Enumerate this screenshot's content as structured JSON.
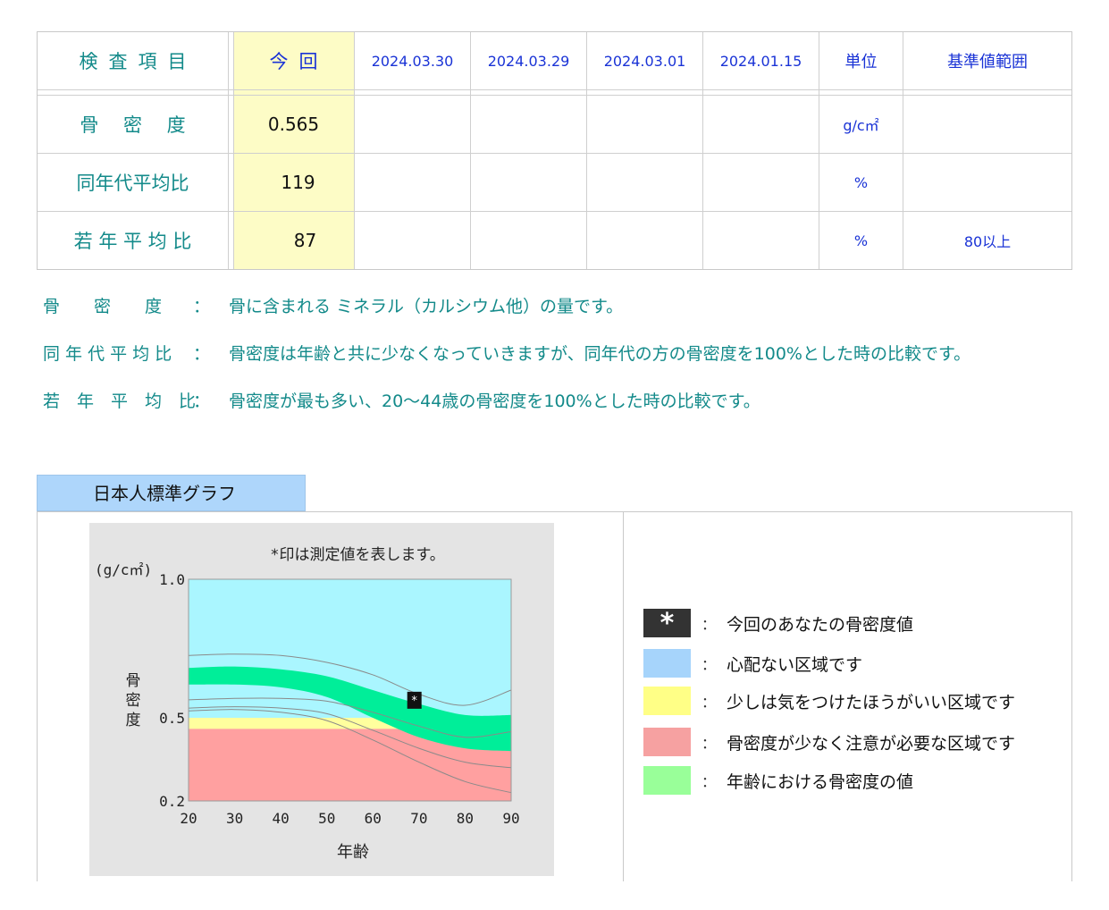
{
  "table": {
    "headers": {
      "item": "検査項目",
      "current": "今回",
      "dates": [
        "2024.03.30",
        "2024.03.29",
        "2024.03.01",
        "2024.01.15"
      ],
      "unit": "単位",
      "reference": "基準値範囲"
    },
    "rows": [
      {
        "label": "骨　 密　 度",
        "current": "0.565",
        "unit": "g/c㎡",
        "reference": ""
      },
      {
        "label": "同年代平均比",
        "current": "119",
        "unit": "%",
        "reference": ""
      },
      {
        "label": "若 年 平 均 比",
        "current": "87",
        "unit": "%",
        "reference": "80以上"
      }
    ]
  },
  "explanations": [
    {
      "term": "骨　　密　　度",
      "colon": "：",
      "text": "骨に含まれる ミネラル（カルシウム他）の量です。"
    },
    {
      "term": "同 年 代 平 均 比",
      "colon": "：",
      "text": "骨密度は年齢と共に少なくなっていきますが、同年代の方の骨密度を100%とした時の比較です。"
    },
    {
      "term": "若　年　平　均　比",
      "colon": "：",
      "text": "骨密度が最も多い、20〜44歳の骨密度を100%とした時の比較です。"
    }
  ],
  "graph": {
    "title": "日本人標準グラフ",
    "note": "*印は測定値を表します。",
    "unit_label": "(g/c㎡)",
    "y_label": "骨密度",
    "x_label": "年齢",
    "marker": "*"
  },
  "chart_data": {
    "type": "area",
    "xlabel": "年齢",
    "ylabel": "骨密度",
    "xlim": [
      20,
      90
    ],
    "ylim": [
      0.2,
      1.0
    ],
    "x_ticks": [
      20,
      30,
      40,
      50,
      60,
      70,
      80,
      90
    ],
    "y_ticks": [
      1.0,
      0.5,
      0.2
    ],
    "y_tick_labels": [
      "1.0",
      "0.5",
      "0.2"
    ],
    "zones": [
      {
        "name": "心配ない区域",
        "from": 0.5,
        "to": 1.0,
        "color": "#aaf6ff"
      },
      {
        "name": "少しは気をつけたほうがいい区域",
        "from": 0.46,
        "to": 0.5,
        "color": "#ffff9e"
      },
      {
        "name": "骨密度が少なく注意が必要な区域",
        "from": 0.2,
        "to": 0.46,
        "color": "#ffa0a0"
      }
    ],
    "age_band": {
      "color": "#00ee99",
      "x": [
        20,
        30,
        40,
        50,
        60,
        70,
        80,
        90
      ],
      "upper": [
        0.68,
        0.685,
        0.675,
        0.65,
        0.6,
        0.55,
        0.51,
        0.51
      ],
      "lower": [
        0.62,
        0.62,
        0.61,
        0.575,
        0.5,
        0.43,
        0.39,
        0.38
      ]
    },
    "reference_lines": [
      {
        "x": [
          20,
          30,
          40,
          50,
          60,
          70,
          80,
          90
        ],
        "y": [
          0.725,
          0.73,
          0.725,
          0.7,
          0.655,
          0.585,
          0.545,
          0.6
        ]
      },
      {
        "x": [
          20,
          30,
          40,
          50,
          60,
          70,
          80,
          90
        ],
        "y": [
          0.565,
          0.57,
          0.57,
          0.56,
          0.52,
          0.47,
          0.43,
          0.45
        ]
      },
      {
        "x": [
          20,
          30,
          40,
          50,
          60,
          70,
          80,
          90
        ],
        "y": [
          0.535,
          0.54,
          0.535,
          0.515,
          0.455,
          0.39,
          0.34,
          0.32
        ]
      },
      {
        "x": [
          20,
          30,
          40,
          50,
          60,
          70,
          80,
          90
        ],
        "y": [
          0.525,
          0.53,
          0.52,
          0.49,
          0.42,
          0.34,
          0.27,
          0.23
        ]
      }
    ],
    "measured": {
      "age": 69,
      "value": 0.565
    }
  },
  "legend": [
    {
      "color": "#333333",
      "symbol": "*",
      "colon": "：",
      "text": "今回のあなたの骨密度値"
    },
    {
      "color": "#a6d4fb",
      "symbol": "",
      "colon": "：",
      "text": "心配ない区域です"
    },
    {
      "color": "#ffff86",
      "symbol": "",
      "colon": "：",
      "text": "少しは気をつけたほうがいい区域です"
    },
    {
      "color": "#f6a1a1",
      "symbol": "",
      "colon": "：",
      "text": "骨密度が少なく注意が必要な区域です"
    },
    {
      "color": "#99ff99",
      "symbol": "",
      "colon": "：",
      "text": "年齢における骨密度の値"
    }
  ]
}
